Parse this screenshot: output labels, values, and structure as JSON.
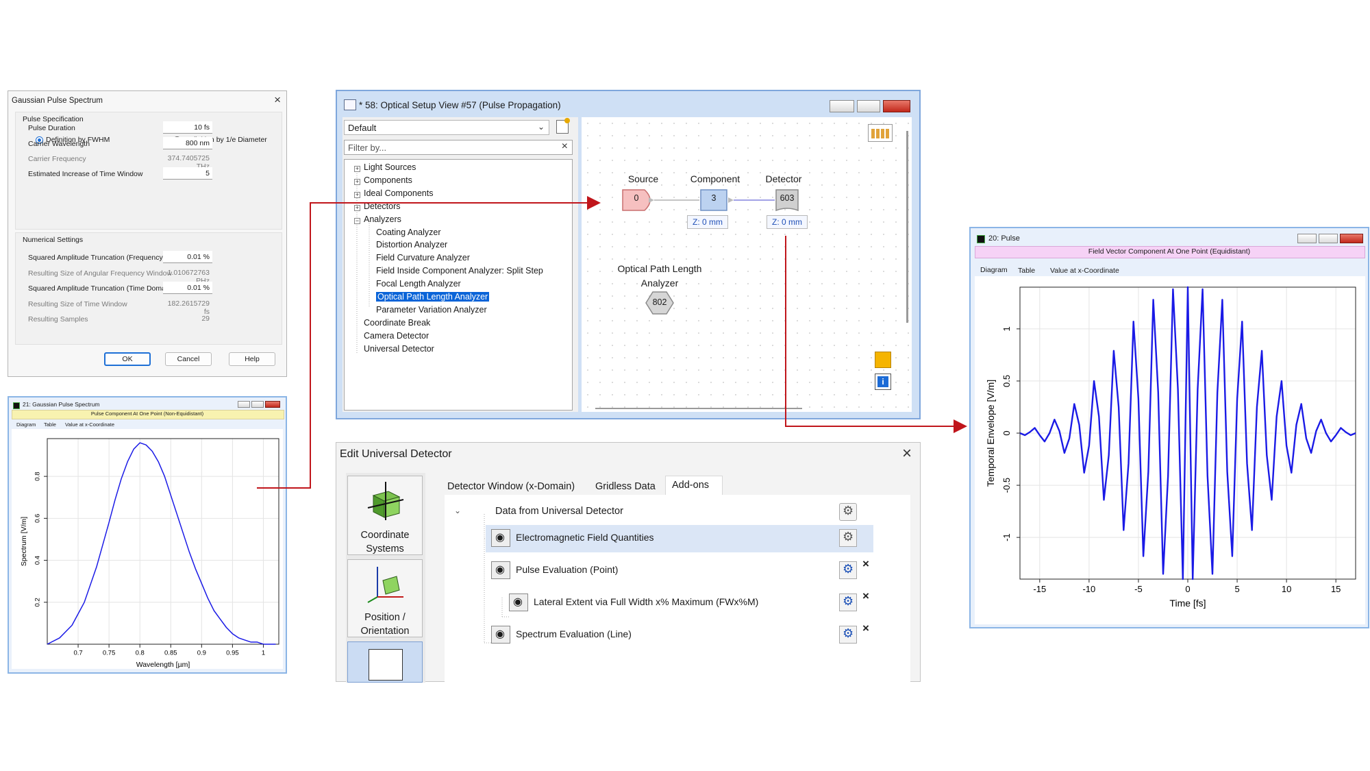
{
  "gaussian_dialog": {
    "title": "Gaussian Pulse Spectrum",
    "section1": "Pulse Specification",
    "radio_fwhm": "Definition by FWHM",
    "radio_1e": "Definition by 1/e Diameter",
    "rows1": [
      {
        "label": "Pulse Duration",
        "value": "10 fs",
        "editable": true
      },
      {
        "label": "Carrier Wavelength",
        "value": "800 nm",
        "editable": true
      },
      {
        "label": "Carrier Frequency",
        "value": "374.7405725 THz",
        "editable": false
      },
      {
        "label": "Estimated Increase of Time Window",
        "value": "5",
        "editable": true
      }
    ],
    "section2": "Numerical Settings",
    "rows2": [
      {
        "label": "Squared Amplitude Truncation (Frequency Domain)",
        "value": "0.01 %",
        "editable": true
      },
      {
        "label": "Resulting Size of Angular Frequency Window",
        "value": "1.010672763 PHz",
        "editable": false
      },
      {
        "label": "Squared Amplitude Truncation (Time Domain)",
        "value": "0.01 %",
        "editable": true
      },
      {
        "label": "Resulting Size of Time Window",
        "value": "182.2615729 fs",
        "editable": false
      },
      {
        "label": "Resulting Samples",
        "value": "29",
        "editable": false
      }
    ],
    "ok": "OK",
    "cancel": "Cancel",
    "help": "Help"
  },
  "spectrum_window": {
    "title": "21: Gaussian Pulse Spectrum",
    "subtitle": "Pulse Component At One Point (Non-Equidistant)",
    "tabs": [
      "Diagram",
      "Table",
      "Value at x-Coordinate"
    ]
  },
  "setup_view": {
    "title": "* 58: Optical Setup View #57 (Pulse Propagation)",
    "dropdown": "Default",
    "filter_placeholder": "Filter by...",
    "tree": [
      {
        "label": "Light Sources",
        "level": 0,
        "expander": true
      },
      {
        "label": "Components",
        "level": 0,
        "expander": true
      },
      {
        "label": "Ideal Components",
        "level": 0,
        "expander": true
      },
      {
        "label": "Detectors",
        "level": 0,
        "expander": true
      },
      {
        "label": "Analyzers",
        "level": 0,
        "expander": true,
        "expanded": true
      },
      {
        "label": "Coating Analyzer",
        "level": 1
      },
      {
        "label": "Distortion Analyzer",
        "level": 1
      },
      {
        "label": "Field Curvature Analyzer",
        "level": 1
      },
      {
        "label": "Field Inside Component Analyzer: Split Step",
        "level": 1
      },
      {
        "label": "Focal Length Analyzer",
        "level": 1
      },
      {
        "label": "Optical Path Length Analyzer",
        "level": 1,
        "selected": true
      },
      {
        "label": "Parameter Variation Analyzer",
        "level": 1
      },
      {
        "label": "Coordinate Break",
        "level": 0
      },
      {
        "label": "Camera Detector",
        "level": 0
      },
      {
        "label": "Universal Detector",
        "level": 0
      }
    ],
    "nodes": {
      "source_label": "Source",
      "source_id": "0",
      "component_label": "Component",
      "component_id": "3",
      "component_z": "Z: 0 mm",
      "detector_label": "Detector",
      "detector_id": "603",
      "detector_z": "Z: 0 mm",
      "analyzer_label_1": "Optical Path Length",
      "analyzer_label_2": "Analyzer",
      "analyzer_id": "802"
    }
  },
  "edit_detector": {
    "title": "Edit Universal Detector",
    "side_items": [
      {
        "label1": "Coordinate",
        "label2": "Systems"
      },
      {
        "label1": "Position /",
        "label2": "Orientation"
      }
    ],
    "tabs": [
      "Detector Window (x-Domain)",
      "Gridless Data",
      "Add-ons"
    ],
    "root": "Data from Universal Detector",
    "items": [
      {
        "label": "Electromagnetic Field Quantities",
        "removable": false,
        "selected": true
      },
      {
        "label": "Pulse Evaluation (Point)",
        "removable": true
      },
      {
        "label": "Lateral Extent via Full Width x% Maximum (FWx%M)",
        "removable": true
      },
      {
        "label": "Spectrum Evaluation (Line)",
        "removable": true
      }
    ],
    "remove_glyph": "×"
  },
  "pulse_window": {
    "title": "20: Pulse",
    "subtitle": "Field Vector Component At One Point (Equidistant)",
    "tabs": [
      "Diagram",
      "Table",
      "Value at x-Coordinate"
    ]
  },
  "colors": {
    "plot_line": "#1a1ae6",
    "arrow": "#c0151b",
    "selection": "#0a64d8",
    "header_pink": "#f6d2f6"
  },
  "chart_data": [
    {
      "type": "line",
      "xlabel": "Wavelength [µm]",
      "ylabel": "Spectrum [V/m]",
      "xlim": [
        0.65,
        1.025
      ],
      "ylim": [
        0,
        0.98
      ],
      "xticks": [
        0.7,
        0.75,
        0.8,
        0.85,
        0.9,
        0.95,
        1
      ],
      "yticks": [
        0.2,
        0.4,
        0.6,
        0.8
      ],
      "x": [
        0.65,
        0.67,
        0.69,
        0.71,
        0.73,
        0.75,
        0.76,
        0.77,
        0.78,
        0.79,
        0.8,
        0.81,
        0.82,
        0.83,
        0.84,
        0.85,
        0.86,
        0.87,
        0.88,
        0.89,
        0.9,
        0.91,
        0.92,
        0.93,
        0.94,
        0.95,
        0.96,
        0.97,
        0.98,
        0.99,
        1.0,
        1.02
      ],
      "y": [
        0.0,
        0.03,
        0.09,
        0.2,
        0.37,
        0.58,
        0.69,
        0.79,
        0.87,
        0.93,
        0.96,
        0.95,
        0.92,
        0.87,
        0.8,
        0.71,
        0.62,
        0.53,
        0.44,
        0.36,
        0.29,
        0.22,
        0.16,
        0.12,
        0.08,
        0.05,
        0.03,
        0.02,
        0.01,
        0.01,
        0.0,
        0.0
      ]
    },
    {
      "type": "line",
      "xlabel": "Time [fs]",
      "ylabel": "Temporal Envelope [V/m]",
      "xlim": [
        -17,
        17
      ],
      "ylim": [
        -1.4,
        1.4
      ],
      "xticks": [
        -15,
        -10,
        -5,
        0,
        5,
        10,
        15
      ],
      "yticks": [
        -1,
        -0.5,
        0,
        0.5,
        1
      ],
      "x": [
        -17,
        -16.5,
        -16,
        -15.5,
        -15,
        -14.5,
        -14,
        -13.5,
        -13,
        -12.5,
        -12,
        -11.5,
        -11,
        -10.5,
        -10,
        -9.5,
        -9,
        -8.5,
        -8,
        -7.5,
        -7,
        -6.5,
        -6,
        -5.5,
        -5,
        -4.5,
        -4,
        -3.5,
        -3,
        -2.5,
        -2,
        -1.5,
        -1,
        -0.5,
        0,
        0.5,
        1,
        1.5,
        2,
        2.5,
        3,
        3.5,
        4,
        4.5,
        5,
        5.5,
        6,
        6.5,
        7,
        7.5,
        8,
        8.5,
        9,
        9.5,
        10,
        10.5,
        11,
        11.5,
        12,
        12.5,
        13,
        13.5,
        14,
        14.5,
        15,
        15.5,
        16,
        16.5,
        17
      ],
      "y": [
        0.0,
        -0.02,
        0.01,
        0.05,
        -0.02,
        -0.08,
        0.0,
        0.13,
        0.02,
        -0.19,
        -0.05,
        0.28,
        0.08,
        -0.38,
        -0.12,
        0.5,
        0.16,
        -0.64,
        -0.21,
        0.79,
        0.25,
        -0.93,
        -0.29,
        1.07,
        0.33,
        -1.18,
        -0.37,
        1.28,
        0.39,
        -1.35,
        -0.41,
        1.38,
        0.42,
        -1.4,
        1.4,
        -1.4,
        0.42,
        1.38,
        -0.41,
        -1.35,
        0.39,
        1.28,
        -0.37,
        -1.18,
        0.33,
        1.07,
        -0.29,
        -0.93,
        0.25,
        0.79,
        -0.21,
        -0.64,
        0.16,
        0.5,
        -0.12,
        -0.38,
        0.08,
        0.28,
        -0.05,
        -0.19,
        0.02,
        0.13,
        0.0,
        -0.08,
        -0.02,
        0.05,
        0.01,
        -0.02,
        0.0
      ]
    }
  ]
}
